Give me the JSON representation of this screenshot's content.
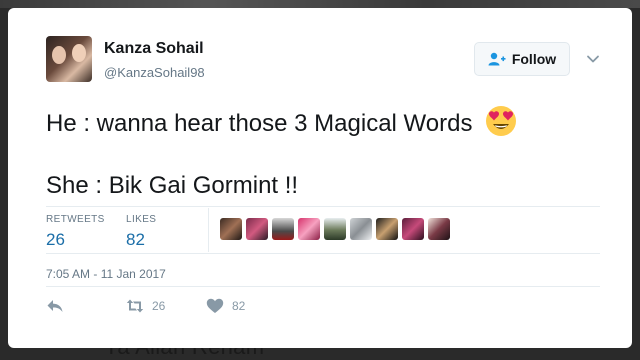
{
  "tweet": {
    "author": {
      "display_name": "Kanza Sohail",
      "handle": "@KanzaSohail98"
    },
    "follow_label": "Follow",
    "text_line1": "He : wanna hear those 3 Magical Words",
    "text_line1_emoji": "heart-eyes-emoji",
    "text_line2": "She : Bik Gai Gormint !!",
    "stats": {
      "retweets_label": "RETWEETS",
      "retweets_value": "26",
      "likes_label": "LIKES",
      "likes_value": "82"
    },
    "liker_avatar_count": 9,
    "timestamp": "7:05 AM - 11 Jan 2017",
    "actions": {
      "reply_icon": "reply-icon",
      "retweet_icon": "retweet-icon",
      "retweet_count": "26",
      "like_icon": "heart-icon",
      "like_count": "82"
    }
  },
  "background": {
    "partial_caption": "Ya Allah Reham"
  },
  "colors": {
    "accent_blue": "#1b6ea8",
    "muted_gray": "#657786",
    "text_dark": "#14171a"
  }
}
